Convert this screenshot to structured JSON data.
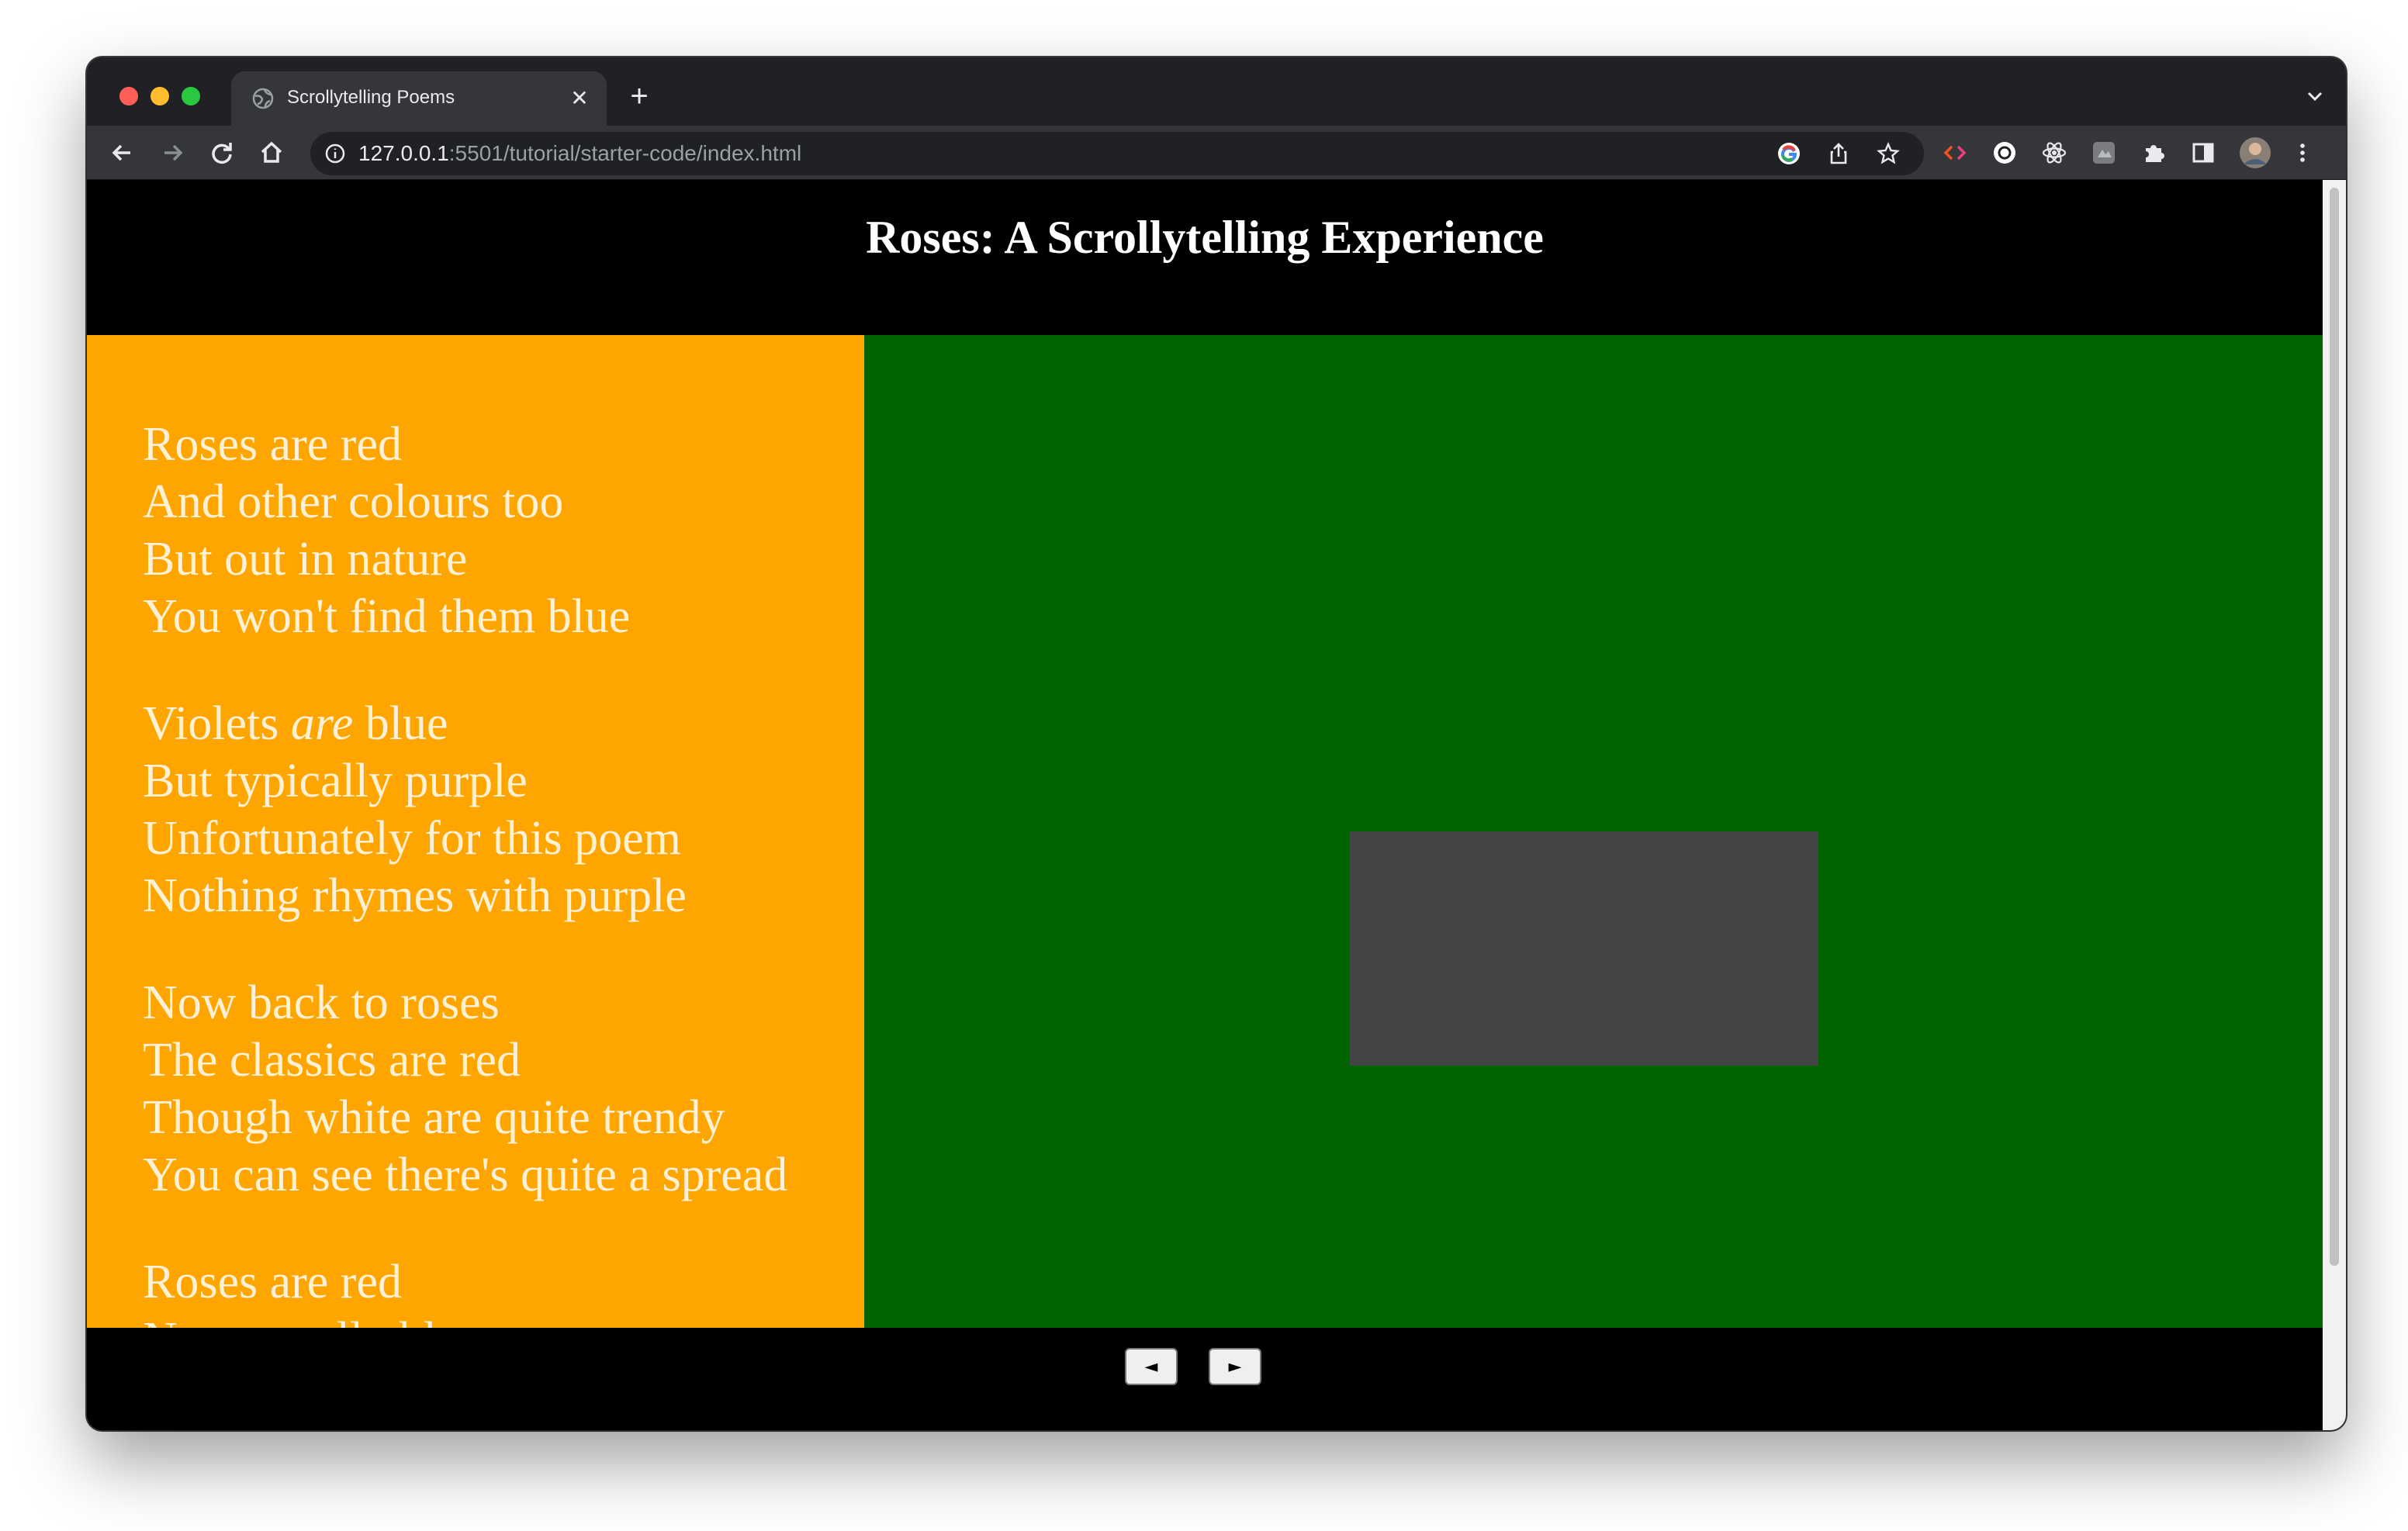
{
  "browser": {
    "tab_title": "Scrollytelling Poems",
    "tab_close_glyph": "✕",
    "new_tab_glyph": "+",
    "url_host": "127.0.0.1",
    "url_path": ":5501/tutorial/starter-code/index.html",
    "icons": [
      "back-icon",
      "forward-icon",
      "reload-icon",
      "home-icon",
      "info-icon",
      "google-lens-icon",
      "share-icon",
      "bookmark-star-icon",
      "devtools-extension-icon",
      "extension-icon",
      "react-devtools-icon",
      "extension-icon",
      "extensions-puzzle-icon",
      "side-panel-icon",
      "profile-avatar",
      "menu-icon"
    ]
  },
  "page": {
    "title": "Roses: A Scrollytelling Experience",
    "stanzas": [
      {
        "lines": [
          "Roses are red",
          "And other colours too",
          "But out in nature",
          "You won't find them blue"
        ]
      },
      {
        "lines": [
          "Violets ",
          "are",
          " blue",
          "But typically purple",
          "Unfortunately for this poem",
          "Nothing rhymes with purple"
        ]
      },
      {
        "lines": [
          "Now back to roses",
          "The classics are red",
          "Though white are quite trendy",
          "You can see there's quite a spread"
        ]
      },
      {
        "lines": [
          "Roses are red",
          "Now usually blue"
        ]
      }
    ],
    "prev_button": "◄",
    "next_button": "►"
  },
  "colors": {
    "poem_panel": "#ffa500",
    "stage": "#006400",
    "stage_box": "#444444",
    "header": "#000000"
  }
}
